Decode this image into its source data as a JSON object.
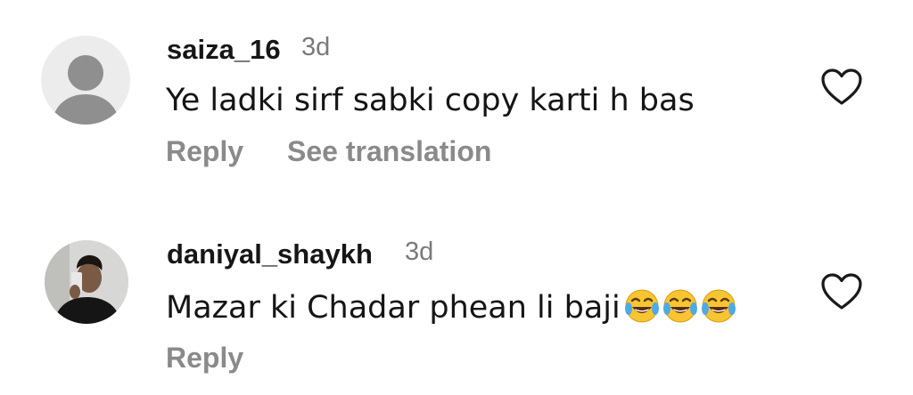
{
  "colors": {
    "username": "#161616",
    "meta": "#7a7a7a",
    "action": "#8a8a8a",
    "avatar_bg": "#ececec",
    "avatar_fg": "#8f8f8f"
  },
  "comments": [
    {
      "username": "saiza_16",
      "time": "3d",
      "text": "Ye ladki sirf sabki copy karti h bas",
      "actions": [
        "Reply",
        "See translation"
      ],
      "avatar": "default-avatar-icon",
      "like_icon": "heart-outline-icon"
    },
    {
      "username": "daniyal_shaykh",
      "time": "3d",
      "text": "Mazar ki Chadar phean li baji",
      "emoji": "😂😂😂",
      "emoji_icon": "face-with-tears-of-joy-icon",
      "actions": [
        "Reply"
      ],
      "avatar": "user-photo-avatar",
      "like_icon": "heart-outline-icon"
    }
  ]
}
